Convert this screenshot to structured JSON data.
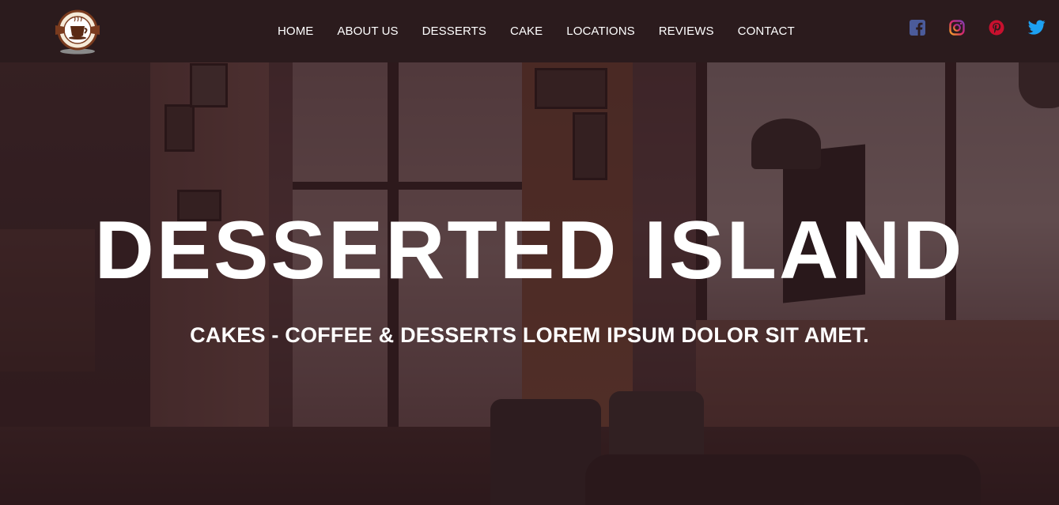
{
  "header": {
    "logo_icon": "coffee-cup-logo-icon",
    "nav": [
      {
        "label": "HOME"
      },
      {
        "label": "ABOUT US"
      },
      {
        "label": "DESSERTS"
      },
      {
        "label": "CAKE"
      },
      {
        "label": "LOCATIONS"
      },
      {
        "label": "REVIEWS"
      },
      {
        "label": "CONTACT"
      }
    ],
    "social": [
      {
        "icon": "facebook-icon",
        "color": "#4b5b9a"
      },
      {
        "icon": "instagram-icon",
        "color": "#c23a8a"
      },
      {
        "icon": "pinterest-icon",
        "color": "#c8102e"
      },
      {
        "icon": "twitter-icon",
        "color": "#1da1f2"
      }
    ]
  },
  "hero": {
    "title": "DESSERTED ISLAND",
    "subtitle": "CAKES - COFFEE & DESSERTS LOREM IPSUM DOLOR SIT AMET.",
    "background": "cafe-interior-photo"
  },
  "colors": {
    "header_bg": "#2b1b1d",
    "overlay": "#30181c",
    "text": "#ffffff"
  }
}
